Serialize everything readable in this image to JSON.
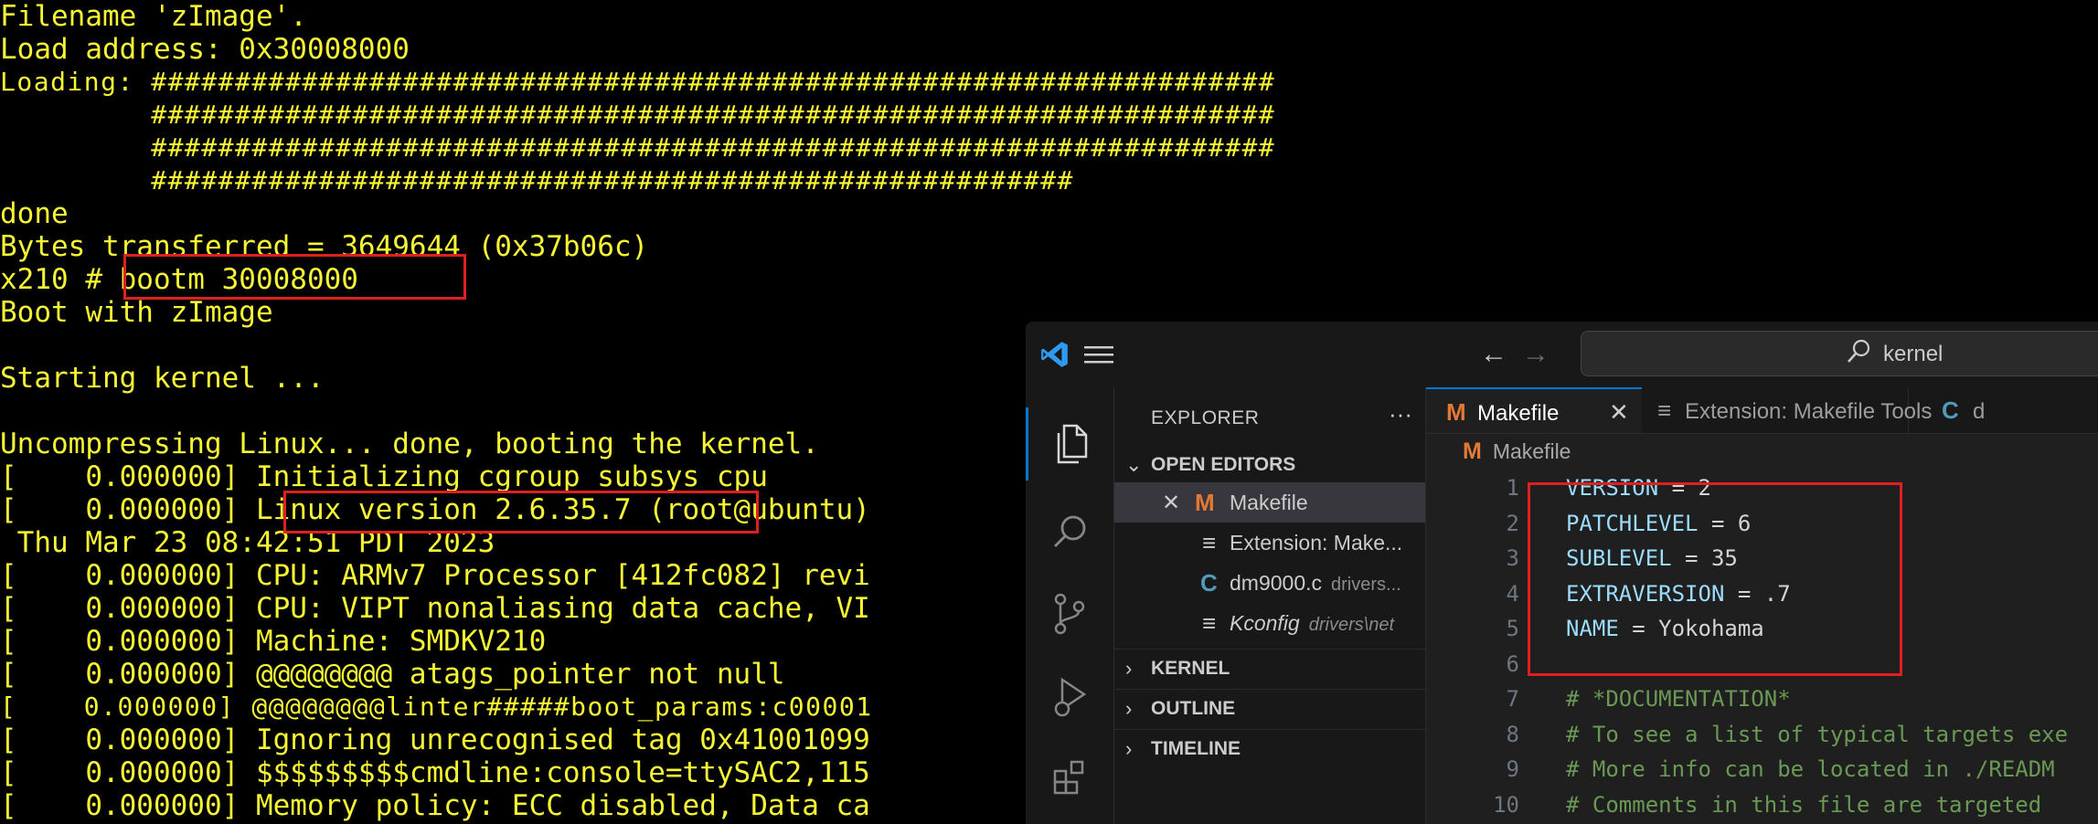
{
  "terminal": {
    "lines": [
      "Filename 'zImage'.",
      "Load address: 0x30008000",
      "Loading: ###################################################################",
      "         ###################################################################",
      "         ###################################################################",
      "         #######################################################",
      "done",
      "Bytes transferred = 3649644 (0x37b06c)",
      "x210 # bootm 30008000",
      "Boot with zImage",
      "",
      "Starting kernel ...",
      "",
      "Uncompressing Linux... done, booting the kernel.",
      "[    0.000000] Initializing cgroup subsys cpu",
      "[    0.000000] Linux version 2.6.35.7 (root@ubuntu)",
      " Thu Mar 23 08:42:51 PDT 2023",
      "[    0.000000] CPU: ARMv7 Processor [412fc082] revi",
      "[    0.000000] CPU: VIPT nonaliasing data cache, VI",
      "[    0.000000] Machine: SMDKV210",
      "[    0.000000] @@@@@@@@ atags_pointer not null",
      "[    0.000000] @@@@@@@@linter#####boot_params:c00001",
      "[    0.000000] Ignoring unrecognised tag 0x41001099",
      "[    0.000000] $$$$$$$$$cmdline:console=ttySAC2,115",
      "[    0.000000] Memory policy: ECC disabled, Data ca"
    ],
    "text_color": "#f5f535",
    "background": "#000000",
    "highlight_color": "#e02020"
  },
  "vscode": {
    "search": {
      "text": "kernel",
      "icon": "search-icon"
    },
    "nav": {
      "back_icon": "arrow-left-icon",
      "forward_icon": "arrow-right-icon"
    },
    "activity_bar": [
      {
        "name": "explorer",
        "icon": "files-icon",
        "active": true
      },
      {
        "name": "search",
        "icon": "search-icon",
        "active": false
      },
      {
        "name": "source-control",
        "icon": "source-control-icon",
        "active": false
      },
      {
        "name": "run-debug",
        "icon": "run-debug-icon",
        "active": false
      },
      {
        "name": "extensions",
        "icon": "extensions-icon",
        "active": false
      }
    ],
    "sidebar": {
      "title": "EXPLORER",
      "more": "···",
      "open_editors_label": "OPEN EDITORS",
      "open_editors": [
        {
          "icon": "M",
          "name": "Makefile",
          "path": "",
          "selected": true,
          "close": "✕"
        },
        {
          "icon": "≡",
          "name": "Extension: Make...",
          "path": ""
        },
        {
          "icon": "C",
          "name": "dm9000.c",
          "path": "drivers..."
        },
        {
          "icon": "≡",
          "name": "Kconfig",
          "path": "drivers\\net"
        }
      ],
      "sections": [
        "KERNEL",
        "OUTLINE",
        "TIMELINE"
      ]
    },
    "tabs": [
      {
        "icon": "M",
        "label": "Makefile",
        "active": true,
        "close": "✕"
      },
      {
        "icon": "≡",
        "label": "Extension: Makefile Tools"
      },
      {
        "icon": "C",
        "label": "d"
      }
    ],
    "breadcrumb": {
      "icon": "M",
      "label": "Makefile"
    },
    "code": [
      {
        "n": "1",
        "key": "VERSION",
        "val": "2"
      },
      {
        "n": "2",
        "key": "PATCHLEVEL",
        "val": "6"
      },
      {
        "n": "3",
        "key": "SUBLEVEL",
        "val": "35"
      },
      {
        "n": "4",
        "key": "EXTRAVERSION",
        "val": ".7"
      },
      {
        "n": "5",
        "key": "NAME",
        "val": "Yokohama"
      },
      {
        "n": "6",
        "text": ""
      },
      {
        "n": "7",
        "text": "# *DOCUMENTATION*",
        "comment": true
      },
      {
        "n": "8",
        "text": "# To see a list of typical targets exe",
        "comment": true
      },
      {
        "n": "9",
        "text": "# More info can be located in ./READM",
        "comment": true
      },
      {
        "n": "10",
        "text": "# Comments in this file are targeted",
        "comment": true
      }
    ],
    "colors": {
      "accent": "#0078d4",
      "makefile_icon": "#e37933",
      "c_icon": "#519aba",
      "comment": "#6a9955",
      "variable": "#9cdcfe"
    }
  }
}
